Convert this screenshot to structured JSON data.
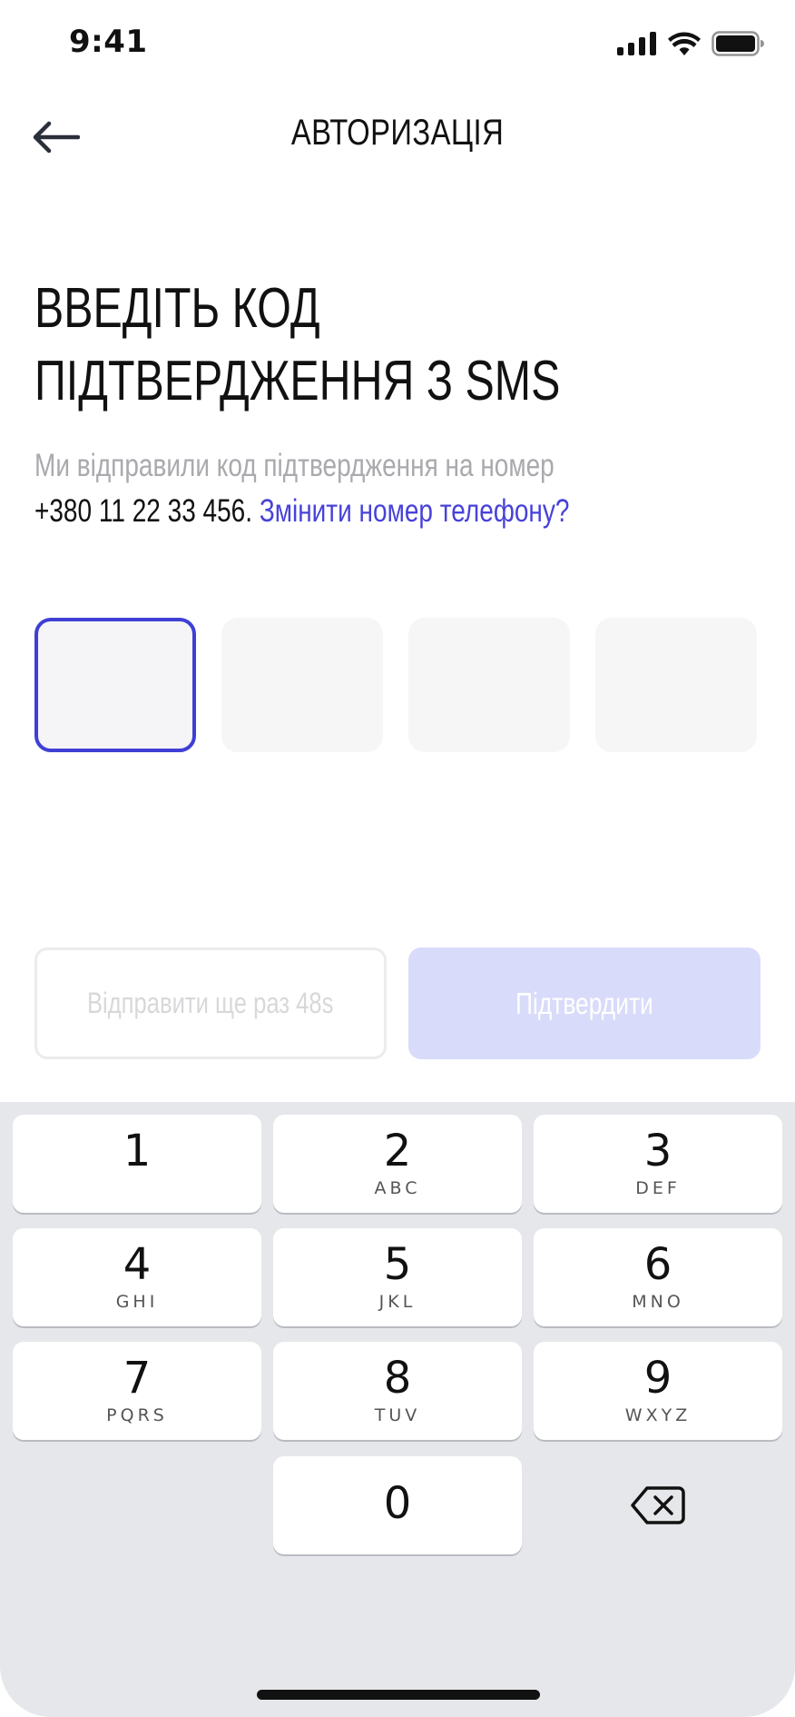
{
  "status_bar": {
    "time": "9:41"
  },
  "nav": {
    "title": "АВТОРИЗАЦІЯ"
  },
  "heading": {
    "line1": "ВВЕДІТЬ КОД",
    "line2": "ПІДТВЕРДЖЕННЯ З SMS"
  },
  "description": {
    "text": "Ми відправили код підтвердження на номер",
    "phone": "+380 11 22 33 456.",
    "change_link": "Змінити номер телефону?"
  },
  "code_inputs": [
    "",
    "",
    "",
    ""
  ],
  "actions": {
    "resend_label": "Відправити ще раз  48s",
    "confirm_label": "Підтвердити"
  },
  "keypad": {
    "keys": [
      {
        "num": "1",
        "letters": ""
      },
      {
        "num": "2",
        "letters": "ABC"
      },
      {
        "num": "3",
        "letters": "DEF"
      },
      {
        "num": "4",
        "letters": "GHI"
      },
      {
        "num": "5",
        "letters": "JKL"
      },
      {
        "num": "6",
        "letters": "MNO"
      },
      {
        "num": "7",
        "letters": "PQRS"
      },
      {
        "num": "8",
        "letters": "TUV"
      },
      {
        "num": "9",
        "letters": "WXYZ"
      },
      {
        "num": "0",
        "letters": ""
      }
    ],
    "delete_icon": "backspace-icon"
  },
  "colors": {
    "accent": "#3f3fd6",
    "link": "#4842d8",
    "confirm_disabled": "#d9dbfa",
    "keypad_bg": "#e6e7ea"
  }
}
